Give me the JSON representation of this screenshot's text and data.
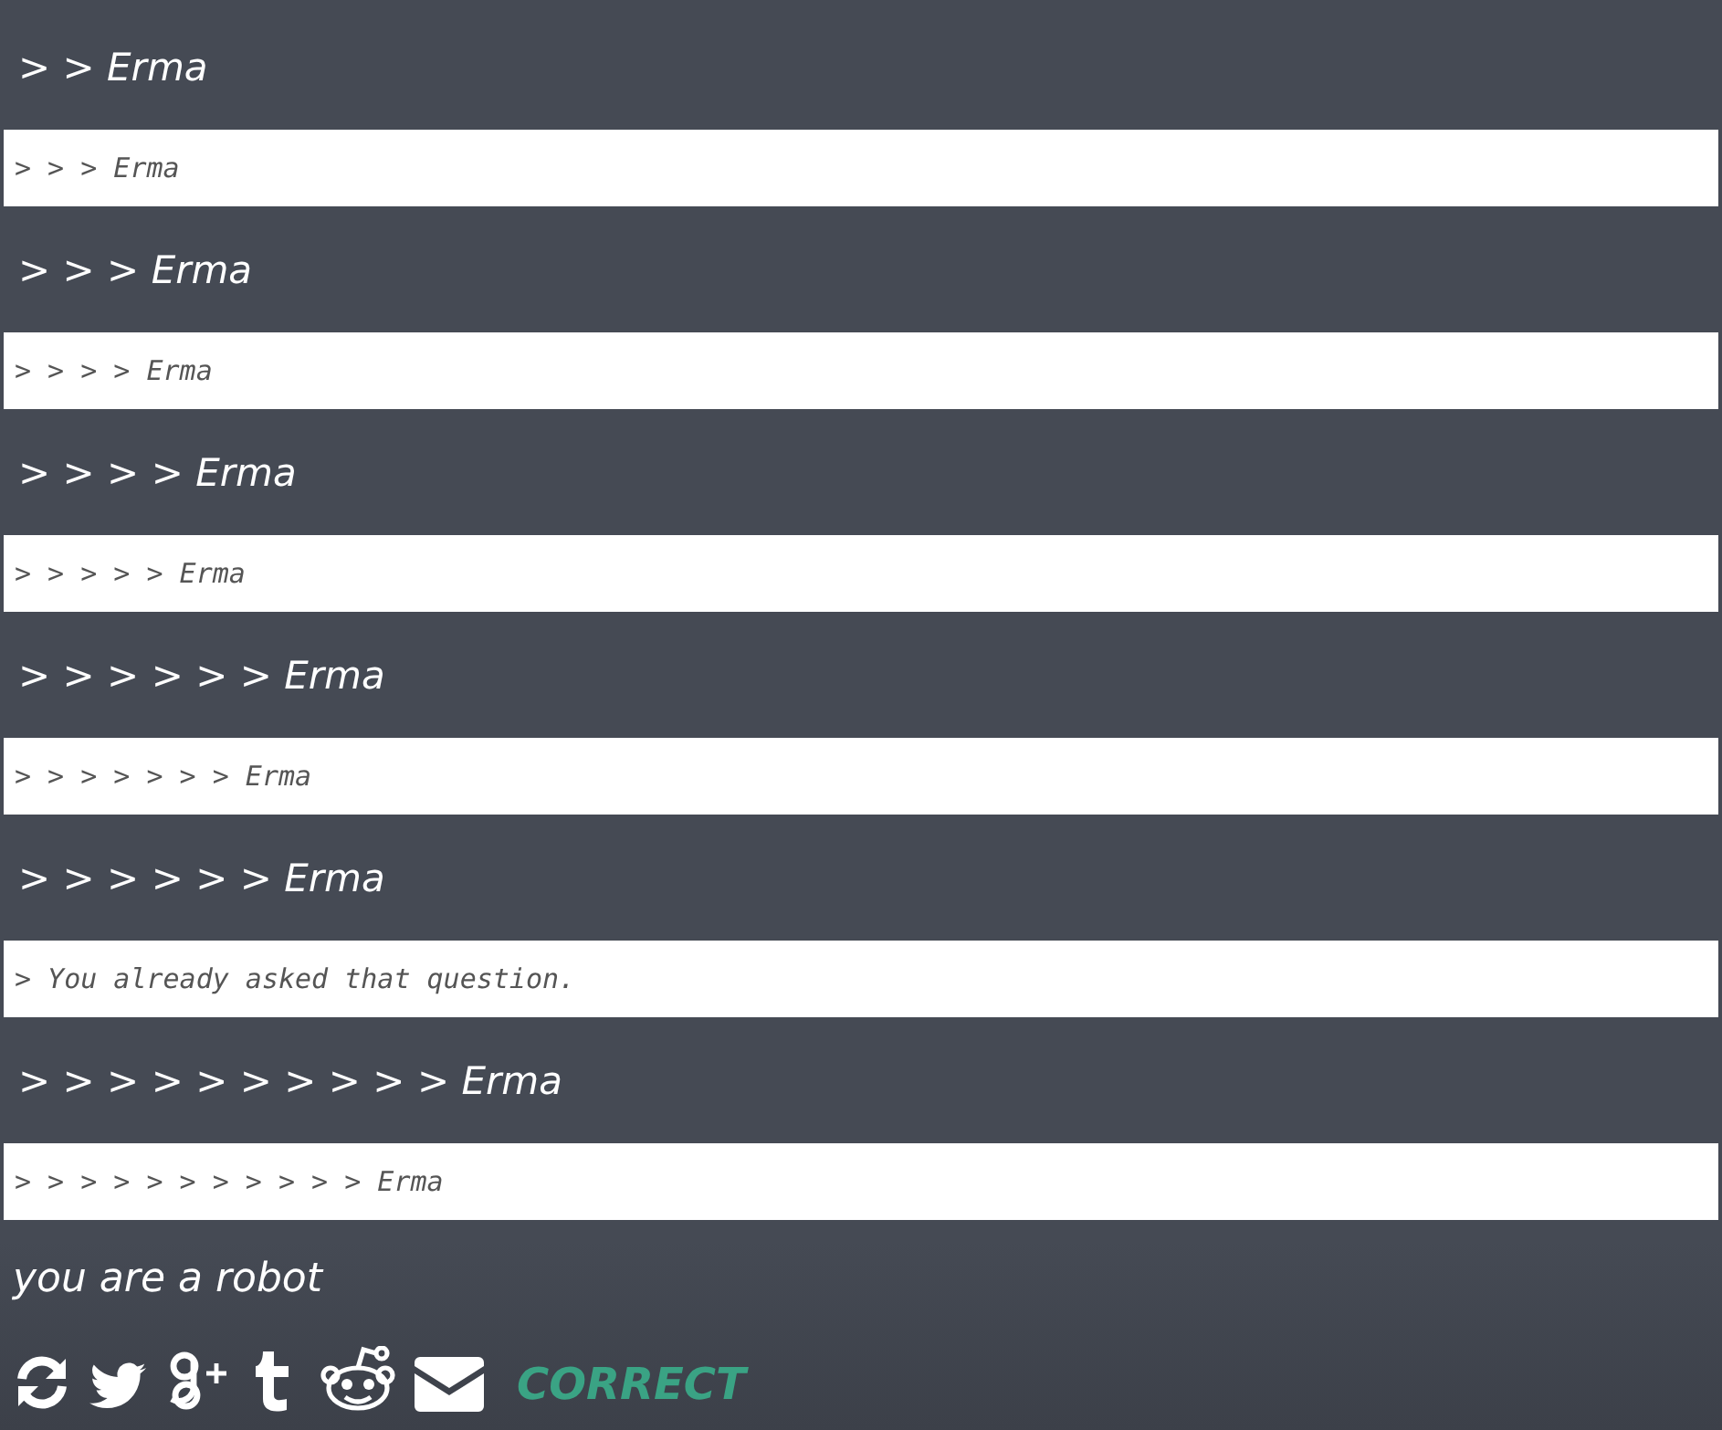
{
  "exchanges": [
    {
      "prompt": "> > Erma",
      "reply": "> > > Erma"
    },
    {
      "prompt": "> > > Erma",
      "reply": "> > > > Erma"
    },
    {
      "prompt": "> > > > Erma",
      "reply": "> > > > > Erma"
    },
    {
      "prompt": "> > > > > > Erma",
      "reply": "> > > > > > > Erma"
    },
    {
      "prompt": "> > > > > > Erma",
      "reply": "> You already asked that question."
    },
    {
      "prompt": "> > > > > > > > > > Erma",
      "reply": "> > > > > > > > > > > Erma"
    }
  ],
  "input": {
    "value": "you are a robot"
  },
  "feedback": "CORRECT"
}
